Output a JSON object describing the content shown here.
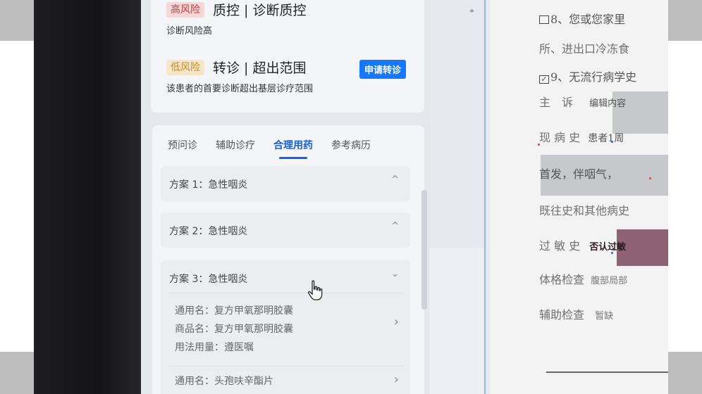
{
  "risk_items": [
    {
      "badge": "高风险",
      "title": "质控 | 诊断质控",
      "desc": "诊断风险高"
    },
    {
      "badge": "低风险",
      "title": "转诊 | 超出范围",
      "desc": "该患者的首要诊断超出基层诊疗范围",
      "action": "申请转诊"
    }
  ],
  "tabs": [
    "预问诊",
    "辅助诊疗",
    "合理用药",
    "参考病历"
  ],
  "plans": [
    {
      "title": "方案 1：急性咽炎",
      "chev": "^"
    },
    {
      "title": "方案 2：急性咽炎",
      "chev": "^"
    },
    {
      "title": "方案 3：急性咽炎",
      "chev": "⌄"
    }
  ],
  "drugs": [
    {
      "generic": "通用名：复方甲氧那明胶囊",
      "brand": "商品名：复方甲氧那明胶囊",
      "usage": "用法用量：遵医嘱"
    },
    {
      "generic": "通用名：头孢呋辛酯片"
    }
  ],
  "document": {
    "line1": "8、您或您家里",
    "line2": "所、进出口冷冻食",
    "line3": "9、无流行病学史",
    "chief_label": "主　诉",
    "chief_value": "编辑内容",
    "hpi_label": "现 病 史",
    "hpi_value": "患者1周",
    "hpi_cont": "首发，伴咽气，",
    "past_label": "既往史和其他病史",
    "allergy_label": "过 敏 史",
    "allergy_value": "否认过敏",
    "exam_label": "体格检查",
    "exam_value": "腹部局部",
    "aux_label": "辅助检查",
    "aux_value": "暂缺"
  },
  "colors": {
    "accent": "#1a5fd6",
    "button": "#1677ff",
    "high_risk": "#c63a3a",
    "low_risk": "#c7892b"
  }
}
